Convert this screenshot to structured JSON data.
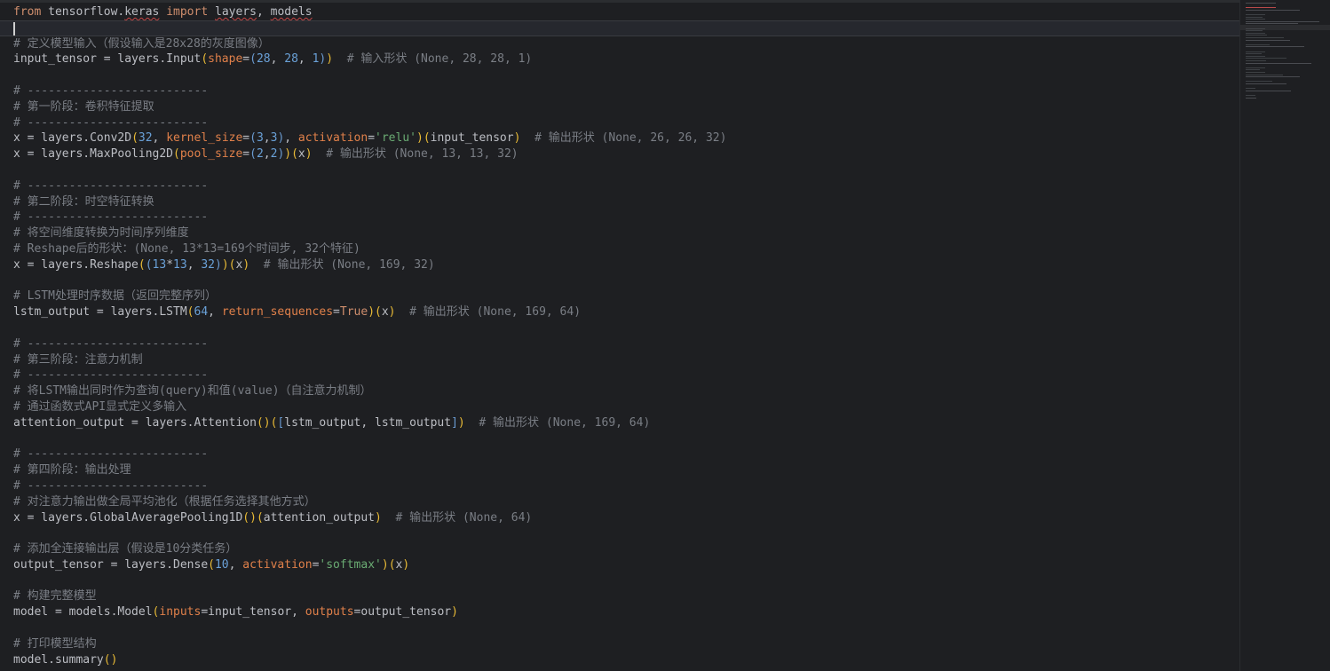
{
  "editor": {
    "language": "python",
    "colors": {
      "background": "#1e1f22",
      "keyword": "#cf8e6d",
      "parameter": "#e0804a",
      "number": "#6aa1d8",
      "string": "#6aab73",
      "comment": "#7a7e85",
      "bracket": "#e8ba36",
      "text": "#bcbec4"
    },
    "current_line": 2,
    "lines": [
      [
        {
          "t": "from",
          "c": "kw"
        },
        {
          "t": " tensorflow."
        },
        {
          "t": "keras",
          "s": 1
        },
        {
          "t": " "
        },
        {
          "t": "import",
          "c": "kw"
        },
        {
          "t": " "
        },
        {
          "t": "layers",
          "s": 1
        },
        {
          "t": ", "
        },
        {
          "t": "models",
          "s": 1
        }
      ],
      [
        {
          "t": "",
          "caret": 1
        }
      ],
      [
        {
          "t": "# 定义模型输入（假设输入是28x28的灰度图像）",
          "c": "cm"
        }
      ],
      [
        {
          "t": "input_tensor = layers.Input"
        },
        {
          "t": "(",
          "c": "br"
        },
        {
          "t": "shape",
          "c": "param"
        },
        {
          "t": "="
        },
        {
          "t": "(",
          "c": "br2"
        },
        {
          "t": "28",
          "c": "num"
        },
        {
          "t": ", "
        },
        {
          "t": "28",
          "c": "num"
        },
        {
          "t": ", "
        },
        {
          "t": "1",
          "c": "num"
        },
        {
          "t": ")",
          "c": "br2"
        },
        {
          "t": ")",
          "c": "br"
        },
        {
          "t": "  "
        },
        {
          "t": "# 输入形状 (None, 28, 28, 1)",
          "c": "cm"
        }
      ],
      [],
      [
        {
          "t": "# --------------------------",
          "c": "cm"
        }
      ],
      [
        {
          "t": "# 第一阶段：卷积特征提取",
          "c": "cm"
        }
      ],
      [
        {
          "t": "# --------------------------",
          "c": "cm"
        }
      ],
      [
        {
          "t": "x = layers.Conv2D"
        },
        {
          "t": "(",
          "c": "br"
        },
        {
          "t": "32",
          "c": "num"
        },
        {
          "t": ", "
        },
        {
          "t": "kernel_size",
          "c": "param"
        },
        {
          "t": "="
        },
        {
          "t": "(",
          "c": "br2"
        },
        {
          "t": "3",
          "c": "num"
        },
        {
          "t": ","
        },
        {
          "t": "3",
          "c": "num"
        },
        {
          "t": ")",
          "c": "br2"
        },
        {
          "t": ", "
        },
        {
          "t": "activation",
          "c": "param"
        },
        {
          "t": "="
        },
        {
          "t": "'relu'",
          "c": "str"
        },
        {
          "t": ")",
          "c": "br"
        },
        {
          "t": "(",
          "c": "br"
        },
        {
          "t": "input_tensor"
        },
        {
          "t": ")",
          "c": "br"
        },
        {
          "t": "  "
        },
        {
          "t": "# 输出形状 (None, 26, 26, 32)",
          "c": "cm"
        }
      ],
      [
        {
          "t": "x = layers.MaxPooling2D"
        },
        {
          "t": "(",
          "c": "br"
        },
        {
          "t": "pool_size",
          "c": "param"
        },
        {
          "t": "="
        },
        {
          "t": "(",
          "c": "br2"
        },
        {
          "t": "2",
          "c": "num"
        },
        {
          "t": ","
        },
        {
          "t": "2",
          "c": "num"
        },
        {
          "t": ")",
          "c": "br2"
        },
        {
          "t": ")",
          "c": "br"
        },
        {
          "t": "(",
          "c": "br"
        },
        {
          "t": "x"
        },
        {
          "t": ")",
          "c": "br"
        },
        {
          "t": "  "
        },
        {
          "t": "# 输出形状 (None, 13, 13, 32)",
          "c": "cm"
        }
      ],
      [],
      [
        {
          "t": "# --------------------------",
          "c": "cm"
        }
      ],
      [
        {
          "t": "# 第二阶段：时空特征转换",
          "c": "cm"
        }
      ],
      [
        {
          "t": "# --------------------------",
          "c": "cm"
        }
      ],
      [
        {
          "t": "# 将空间维度转换为时间序列维度",
          "c": "cm"
        }
      ],
      [
        {
          "t": "# Reshape后的形状：(None, 13*13=169个时间步, 32个特征)",
          "c": "cm"
        }
      ],
      [
        {
          "t": "x = layers.Reshape"
        },
        {
          "t": "(",
          "c": "br"
        },
        {
          "t": "(",
          "c": "br2"
        },
        {
          "t": "13",
          "c": "num"
        },
        {
          "t": "*"
        },
        {
          "t": "13",
          "c": "num"
        },
        {
          "t": ", "
        },
        {
          "t": "32",
          "c": "num"
        },
        {
          "t": ")",
          "c": "br2"
        },
        {
          "t": ")",
          "c": "br"
        },
        {
          "t": "(",
          "c": "br"
        },
        {
          "t": "x"
        },
        {
          "t": ")",
          "c": "br"
        },
        {
          "t": "  "
        },
        {
          "t": "# 输出形状 (None, 169, 32)",
          "c": "cm"
        }
      ],
      [],
      [
        {
          "t": "# LSTM处理时序数据（返回完整序列）",
          "c": "cm"
        }
      ],
      [
        {
          "t": "lstm_output = layers.LSTM"
        },
        {
          "t": "(",
          "c": "br"
        },
        {
          "t": "64",
          "c": "num"
        },
        {
          "t": ", "
        },
        {
          "t": "return_sequences",
          "c": "param"
        },
        {
          "t": "="
        },
        {
          "t": "True",
          "c": "kw"
        },
        {
          "t": ")",
          "c": "br"
        },
        {
          "t": "(",
          "c": "br"
        },
        {
          "t": "x"
        },
        {
          "t": ")",
          "c": "br"
        },
        {
          "t": "  "
        },
        {
          "t": "# 输出形状 (None, 169, 64)",
          "c": "cm"
        }
      ],
      [],
      [
        {
          "t": "# --------------------------",
          "c": "cm"
        }
      ],
      [
        {
          "t": "# 第三阶段：注意力机制",
          "c": "cm"
        }
      ],
      [
        {
          "t": "# --------------------------",
          "c": "cm"
        }
      ],
      [
        {
          "t": "# 将LSTM输出同时作为查询(query)和值(value)（自注意力机制）",
          "c": "cm"
        }
      ],
      [
        {
          "t": "# 通过函数式API显式定义多输入",
          "c": "cm"
        }
      ],
      [
        {
          "t": "attention_output = layers.Attention"
        },
        {
          "t": "()",
          "c": "br"
        },
        {
          "t": "(",
          "c": "br"
        },
        {
          "t": "[",
          "c": "br2"
        },
        {
          "t": "lstm_output, lstm_output"
        },
        {
          "t": "]",
          "c": "br2"
        },
        {
          "t": ")",
          "c": "br"
        },
        {
          "t": "  "
        },
        {
          "t": "# 输出形状 (None, 169, 64)",
          "c": "cm"
        }
      ],
      [],
      [
        {
          "t": "# --------------------------",
          "c": "cm"
        }
      ],
      [
        {
          "t": "# 第四阶段：输出处理",
          "c": "cm"
        }
      ],
      [
        {
          "t": "# --------------------------",
          "c": "cm"
        }
      ],
      [
        {
          "t": "# 对注意力输出做全局平均池化（根据任务选择其他方式）",
          "c": "cm"
        }
      ],
      [
        {
          "t": "x = layers.GlobalAveragePooling1D"
        },
        {
          "t": "()",
          "c": "br"
        },
        {
          "t": "(",
          "c": "br"
        },
        {
          "t": "attention_output"
        },
        {
          "t": ")",
          "c": "br"
        },
        {
          "t": "  "
        },
        {
          "t": "# 输出形状 (None, 64)",
          "c": "cm"
        }
      ],
      [],
      [
        {
          "t": "# 添加全连接输出层（假设是10分类任务）",
          "c": "cm"
        }
      ],
      [
        {
          "t": "output_tensor = layers.Dense"
        },
        {
          "t": "(",
          "c": "br"
        },
        {
          "t": "10",
          "c": "num"
        },
        {
          "t": ", "
        },
        {
          "t": "activation",
          "c": "param"
        },
        {
          "t": "="
        },
        {
          "t": "'softmax'",
          "c": "str"
        },
        {
          "t": ")",
          "c": "br"
        },
        {
          "t": "(",
          "c": "br"
        },
        {
          "t": "x"
        },
        {
          "t": ")",
          "c": "br"
        }
      ],
      [],
      [
        {
          "t": "# 构建完整模型",
          "c": "cm"
        }
      ],
      [
        {
          "t": "model = models.Model"
        },
        {
          "t": "(",
          "c": "br"
        },
        {
          "t": "inputs",
          "c": "param"
        },
        {
          "t": "="
        },
        {
          "t": "input_tensor, "
        },
        {
          "t": "outputs",
          "c": "param"
        },
        {
          "t": "="
        },
        {
          "t": "output_tensor"
        },
        {
          "t": ")",
          "c": "br"
        }
      ],
      [],
      [
        {
          "t": "# 打印模型结构",
          "c": "cm"
        }
      ],
      [
        {
          "t": "model.summary"
        },
        {
          "t": "()",
          "c": "br"
        }
      ]
    ]
  }
}
